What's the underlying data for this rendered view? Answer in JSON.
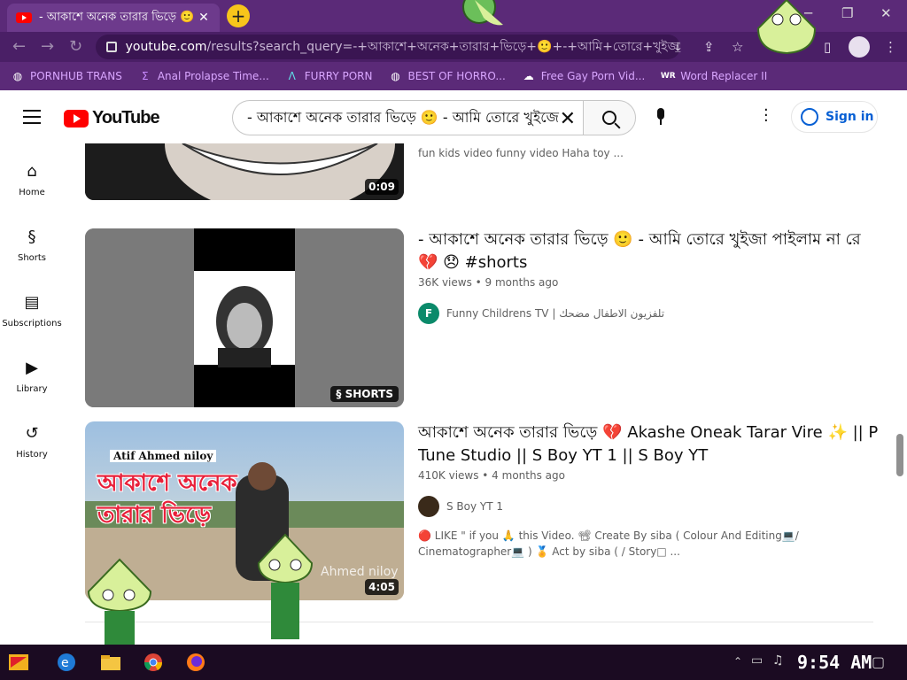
{
  "browser": {
    "tab_title": "- আকাশে অনেক তারার ভিড়ে 🙂 - আমি তোরে খুইজা",
    "url_host": "youtube.com",
    "url_path": "/results?search_query=-+আকাশে+অনেক+তারার+ভিড়ে+🙂+-+আমি+তোরে+খুইজা+...",
    "bookmarks": [
      {
        "label": "PORNHUB TRANS",
        "icon": "globe-icon"
      },
      {
        "label": "Anal Prolapse Time...",
        "icon": "sigma-icon"
      },
      {
        "label": "FURRY PORN",
        "icon": "lambda-icon"
      },
      {
        "label": "BEST OF HORRO...",
        "icon": "globe-icon"
      },
      {
        "label": "Free Gay Porn Vid...",
        "icon": "ghost-icon"
      },
      {
        "label": "Word Replacer II",
        "icon": "wr-icon"
      }
    ]
  },
  "masthead": {
    "logo_text": "YouTube",
    "search_value": "- আকাশে অনেক তারার ভিড়ে 🙂 - আমি তোরে খুইজে",
    "signin_label": "Sign in"
  },
  "guide": {
    "items": [
      {
        "label": "Home",
        "icon": "home-icon"
      },
      {
        "label": "Shorts",
        "icon": "shorts-icon"
      },
      {
        "label": "Subscriptions",
        "icon": "subscriptions-icon"
      },
      {
        "label": "Library",
        "icon": "library-icon"
      },
      {
        "label": "History",
        "icon": "history-icon"
      }
    ]
  },
  "results": [
    {
      "snippet": "fun kids video funny video Haha toy ...",
      "duration": "0:09"
    },
    {
      "title": "- আকাশে অনেক তারার ভিড়ে 🙂 - আমি তোরে খুইজা পাইলাম না রে 💔 😞 #shorts",
      "meta": "36K views • 9 months ago",
      "channel": "Funny Childrens TV | تلفزيون الاطفال مضحك",
      "channel_initial": "F",
      "badge": "SHORTS"
    },
    {
      "title": "আকাশে অনেক তারার ভিড়ে 💔 Akashe Oneak Tarar Vire ✨ || P Tune Studio || S Boy YT 1 || S Boy YT",
      "meta": "410K views • 4 months ago",
      "channel": "S Boy YT 1",
      "snippet": "🔴 LIKE \" if you 🙏 this Video. 📽 Create By siba ( Colour And Editing💻/ Cinematographer💻 ) 🏅 Act by siba ( / Story□ ...",
      "duration": "4:05",
      "thumb_text": "Atif Ahmed niloy",
      "thumb_bengali": "আকাশে অনেক তারার ভিড়ে",
      "thumb_caption": "Ahmed niloy"
    }
  ],
  "taskbar": {
    "clock": "9:54 AM"
  },
  "colors": {
    "chrome_purple": "#5b2a78",
    "bookmark_text": "#d9a6ff",
    "yt_red": "#ff0000",
    "link_blue": "#065fd4"
  }
}
